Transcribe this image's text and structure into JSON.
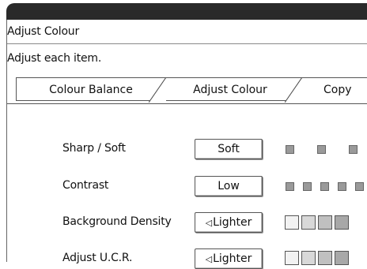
{
  "window": {
    "title": "Adjust Colour",
    "instruction": "Adjust each item."
  },
  "tabs": [
    {
      "label": "Colour Balance"
    },
    {
      "label": "Adjust Colour"
    },
    {
      "label": "Copy Qua"
    }
  ],
  "rows": [
    {
      "label": "Sharp / Soft",
      "value": "Soft"
    },
    {
      "label": "Contrast",
      "value": "Low"
    },
    {
      "label": "Background Density",
      "value": "Lighter",
      "glyph": "◁"
    },
    {
      "label": "Adjust U.C.R.",
      "value": "Lighter",
      "glyph": "◁"
    }
  ]
}
